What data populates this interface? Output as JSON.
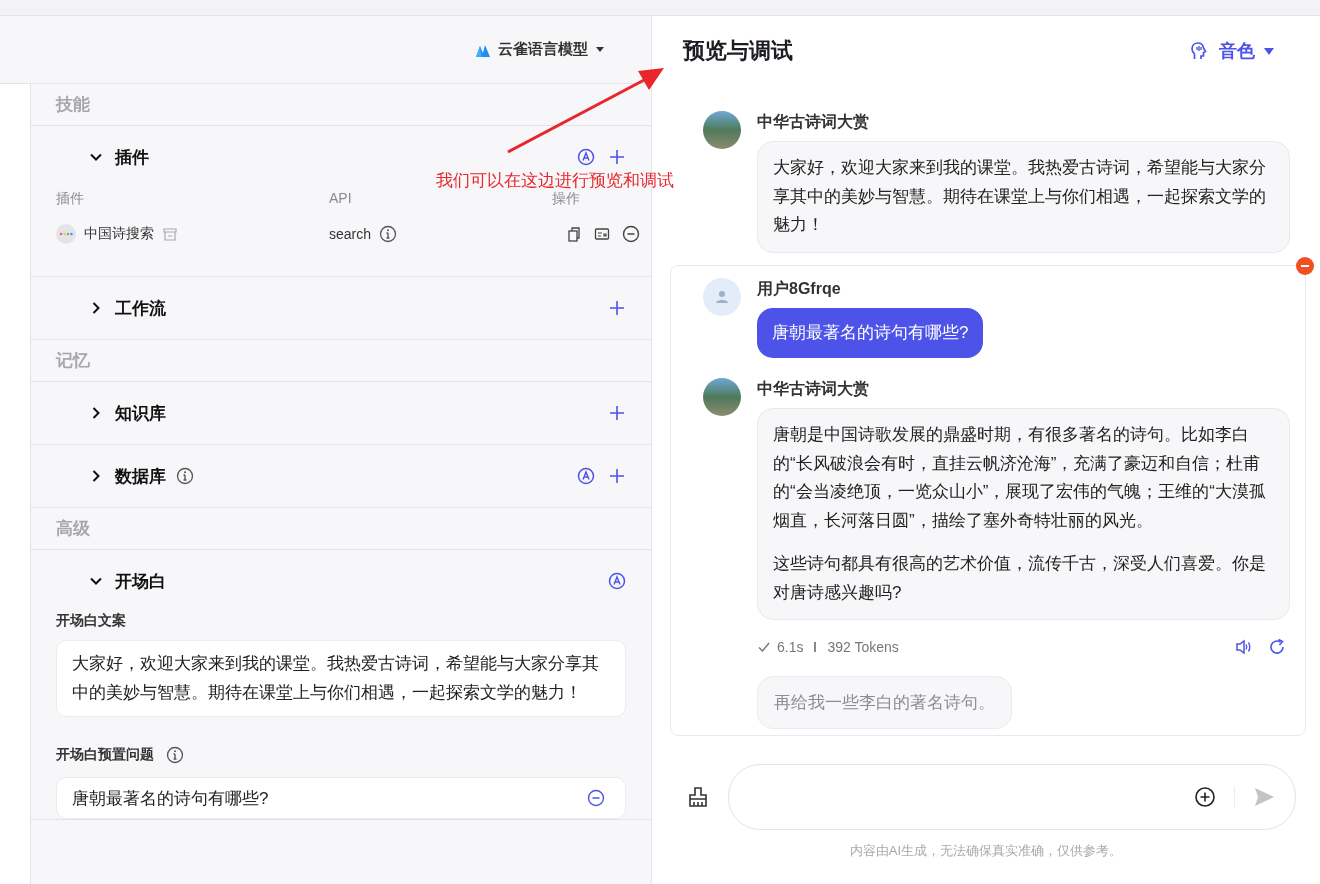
{
  "config": {
    "model": "云雀语言模型",
    "sections": [
      {
        "kind": "group",
        "title": "技能"
      },
      {
        "kind": "section",
        "title": "插件",
        "expanded": true,
        "info": false,
        "auto_icon": true,
        "add_icon": true,
        "content": {
          "kind": "plugins",
          "columns": [
            "插件",
            "API",
            "操作"
          ],
          "rows": [
            {
              "name": "中国诗搜索",
              "api": "search"
            }
          ]
        }
      },
      {
        "kind": "section",
        "title": "工作流",
        "expanded": false,
        "info": false,
        "auto_icon": false,
        "add_icon": true
      },
      {
        "kind": "group",
        "title": "记忆"
      },
      {
        "kind": "section",
        "title": "知识库",
        "expanded": false,
        "info": false,
        "auto_icon": false,
        "add_icon": true
      },
      {
        "kind": "section",
        "title": "数据库",
        "expanded": false,
        "info": true,
        "auto_icon": true,
        "add_icon": true
      },
      {
        "kind": "group",
        "title": "高级"
      },
      {
        "kind": "section",
        "title": "开场白",
        "expanded": true,
        "info": false,
        "auto_icon": true,
        "add_icon": false,
        "content": {
          "kind": "opening",
          "text_label": "开场白文案",
          "text": "大家好，欢迎大家来到我的课堂。我热爱古诗词，希望能与大家分享其中的美妙与智慧。期待在课堂上与你们相遇，一起探索文学的魅力！",
          "questions_label": "开场白预置问题",
          "questions": [
            "唐朝最著名的诗句有哪些?"
          ]
        }
      }
    ]
  },
  "annotation": {
    "text": "我们可以在这边进行预览和调试"
  },
  "preview": {
    "title": "预览与调试",
    "voice": "音色",
    "messages": [
      {
        "kind": "bot",
        "name": "中华古诗词大赏",
        "paragraphs": [
          "大家好，欢迎大家来到我的课堂。我热爱古诗词，希望能与大家分享其中的美妙与智慧。期待在课堂上与你们相遇，一起探索文学的魅力！"
        ]
      }
    ],
    "turn": {
      "hovered": true,
      "messages": [
        {
          "kind": "user",
          "name": "用户8Gfrqe",
          "paragraphs": [
            "唐朝最著名的诗句有哪些?"
          ]
        },
        {
          "kind": "bot",
          "name": "中华古诗词大赏",
          "paragraphs": [
            "唐朝是中国诗歌发展的鼎盛时期，有很多著名的诗句。比如李白的“长风破浪会有时，直挂云帆济沧海”，充满了豪迈和自信；杜甫的“会当凌绝顶，一览众山小”，展现了宏伟的气魄；王维的“大漠孤烟直，长河落日圆”，描绘了塞外奇特壮丽的风光。",
            "这些诗句都具有很高的艺术价值，流传千古，深受人们喜爱。你是对唐诗感兴趣吗?"
          ],
          "time": "6.1s",
          "tokens": "392 Tokens"
        }
      ],
      "suggestion": "再给我一些李白的著名诗句。"
    },
    "disclaimer": "内容由AI生成，无法确保真实准确，仅供参考。"
  }
}
